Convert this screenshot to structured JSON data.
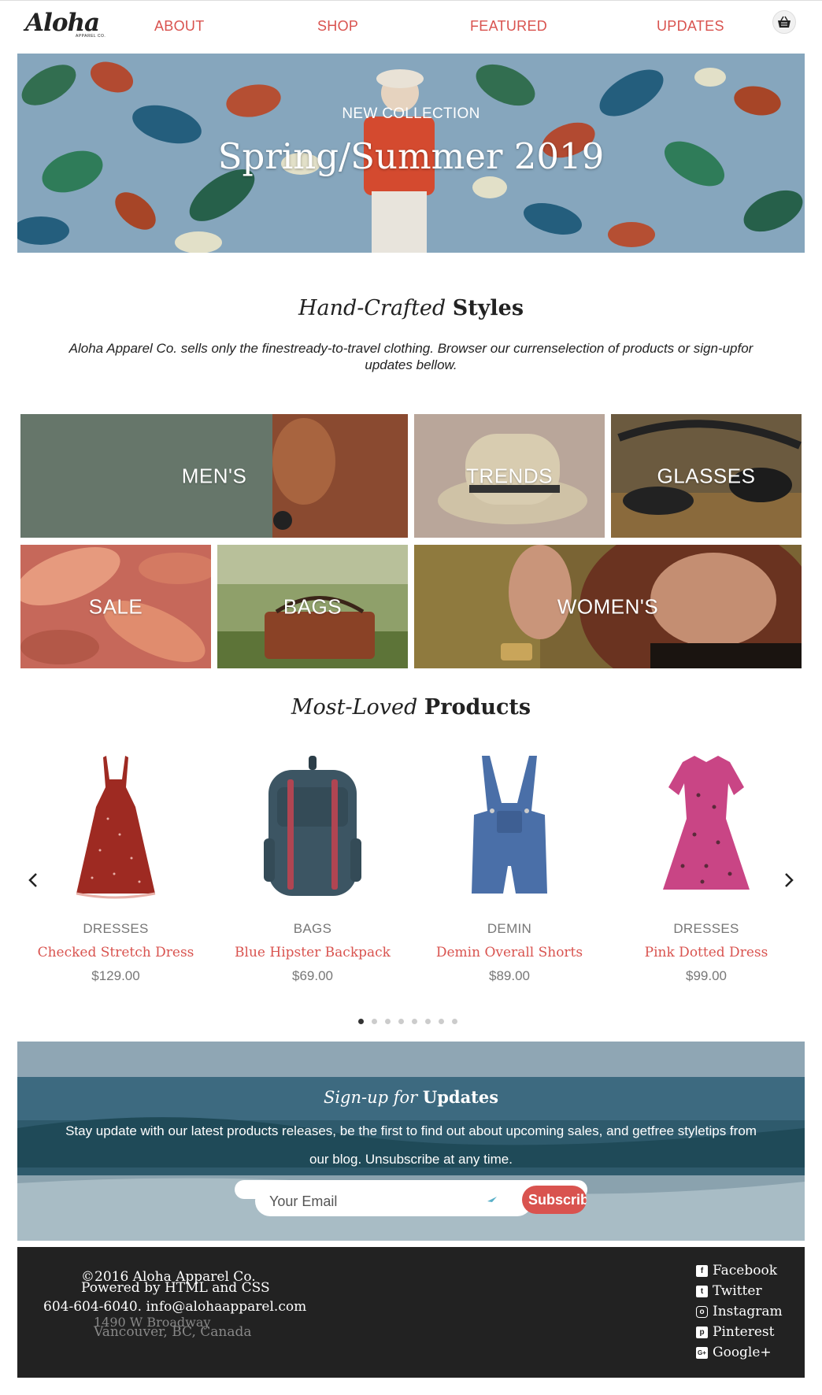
{
  "nav": {
    "logo": "Aloha",
    "logo_sub": "APPAREL CO.",
    "links": [
      "ABOUT",
      "SHOP",
      "FEATURED",
      "UPDATES"
    ],
    "cart_icon": "basket-icon"
  },
  "hero": {
    "subtitle": "NEW COLLECTION",
    "title": "Spring/Summer 2019"
  },
  "intro": {
    "title_italic": "Hand-Crafted",
    "title_bold": "Styles",
    "text": "Aloha Apparel Co. sells only the finestready-to-travel clothing. Browser our currenselection of products or sign-upfor updates bellow."
  },
  "categories": [
    "MEN'S",
    "TRENDS",
    "GLASSES",
    "SALE",
    "BAGS",
    "WOMEN'S"
  ],
  "products_section": {
    "title_italic": "Most-Loved",
    "title_bold": "Products"
  },
  "products": [
    {
      "category": "DRESSES",
      "name": "Checked Stretch Dress",
      "price": "$129.00"
    },
    {
      "category": "BAGS",
      "name": "Blue Hipster Backpack",
      "price": "$69.00"
    },
    {
      "category": "DEMIN",
      "name": "Demin Overall Shorts",
      "price": "$89.00"
    },
    {
      "category": "DRESSES",
      "name": "Pink Dotted Dress",
      "price": "$99.00"
    }
  ],
  "carousel": {
    "page_count": 8,
    "active_index": 0
  },
  "signup": {
    "title_italic": "Sign-up for",
    "title_bold": "Updates",
    "text": "Stay update with our latest products releases, be the first to find out about upcoming sales, and getfree styletips from our blog. Unsubscribe at any time.",
    "email_placeholder": "Your Email",
    "button_label": "Subscribe"
  },
  "footer": {
    "copyright": "©2016 Aloha Apparel Co.",
    "powered": "Powered by HTML and CSS",
    "contact": "604-604-6040. info@alohaapparel.com",
    "address1": "1490 W Broadway",
    "address2": "Vancouver, BC, Canada",
    "social": [
      "Facebook",
      "Twitter",
      "Instagram",
      "Pinterest",
      "Google+"
    ]
  },
  "colors": {
    "accent": "#d9534f",
    "footer_bg": "#222222"
  }
}
